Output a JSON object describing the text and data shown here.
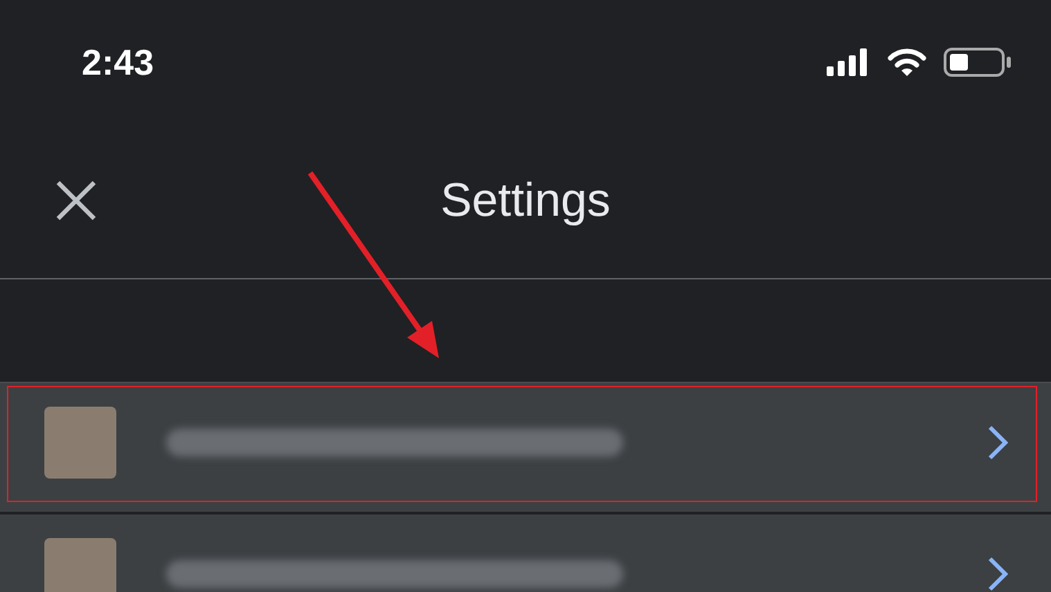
{
  "status_bar": {
    "time": "2:43"
  },
  "header": {
    "title": "Settings"
  },
  "accounts": [
    {
      "highlighted": true
    },
    {
      "highlighted": false
    }
  ]
}
